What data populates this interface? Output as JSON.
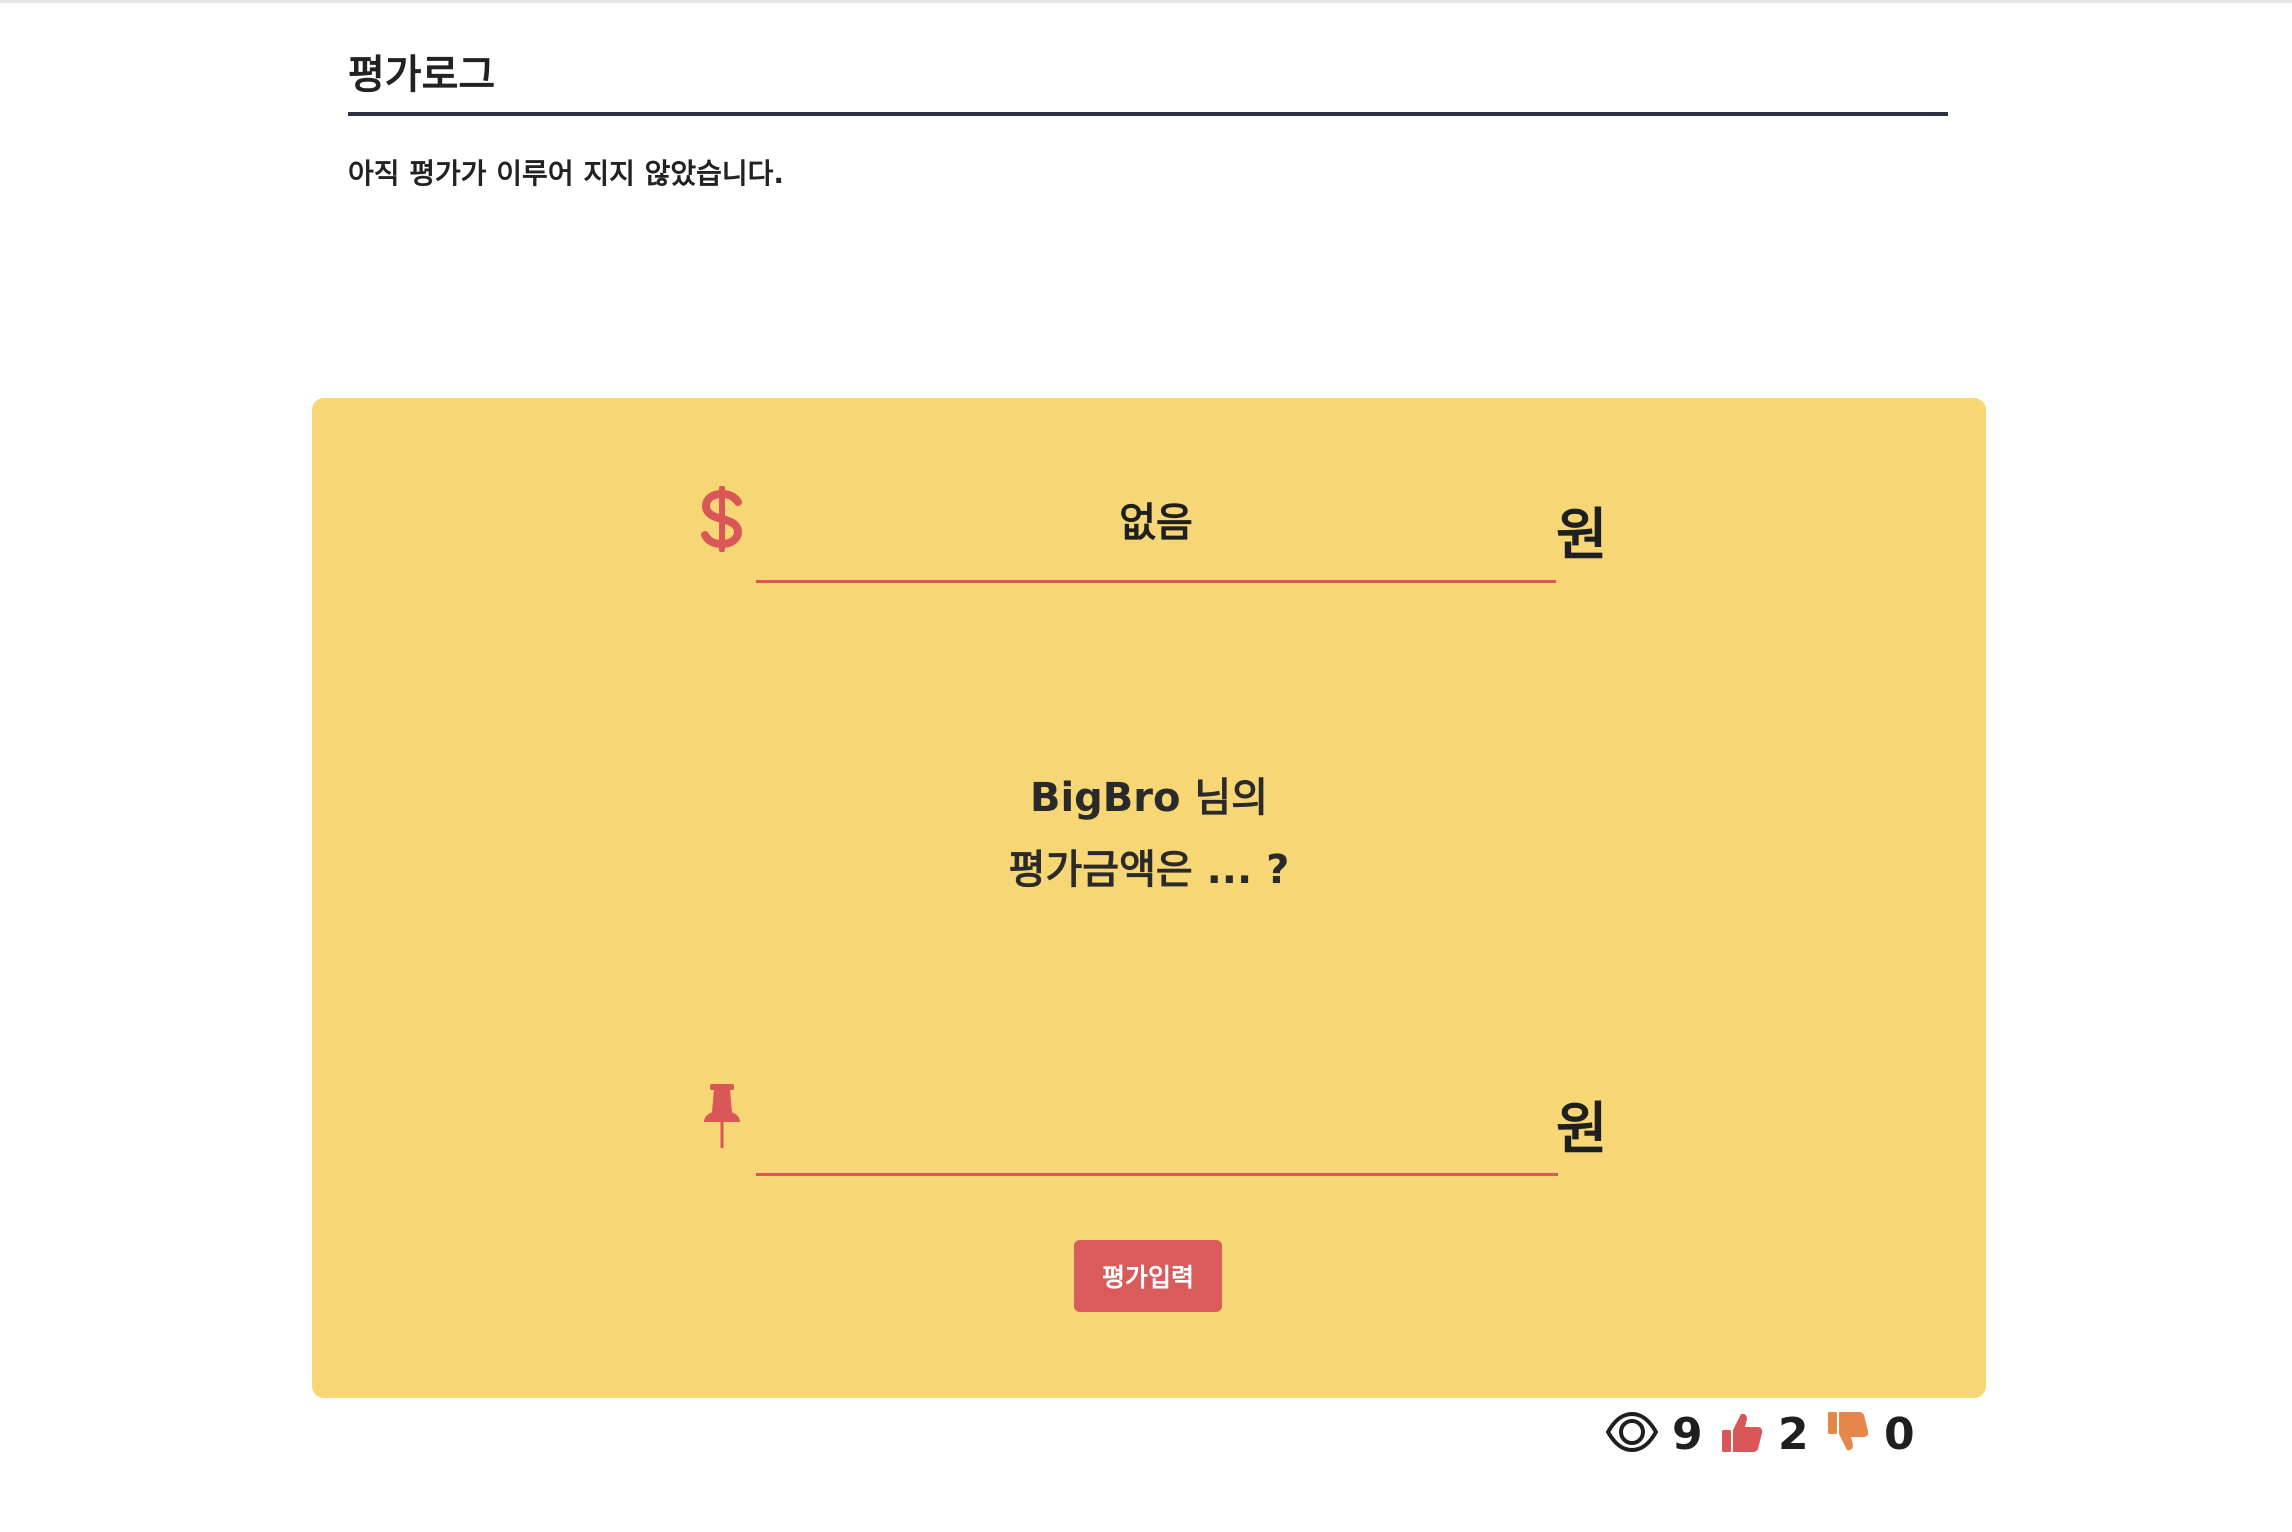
{
  "log": {
    "title": "평가로그",
    "empty_message": "아직 평가가 이루어 지지 않았습니다."
  },
  "card": {
    "current_value": "없음",
    "currency_unit": "원",
    "question_line1": "BigBro 님의",
    "question_line2": "평가금액은 ... ?",
    "input_value": "",
    "input_unit": "원",
    "submit_label": "평가입력"
  },
  "stats": {
    "views": "9",
    "likes": "2",
    "dislikes": "0"
  },
  "colors": {
    "card_bg": "#f7d675",
    "accent_red": "#d95757",
    "dislike_orange": "#e5874a"
  },
  "icons": [
    "dollar-icon",
    "pushpin-icon",
    "eye-icon",
    "thumbs-up-icon",
    "thumbs-down-icon"
  ]
}
